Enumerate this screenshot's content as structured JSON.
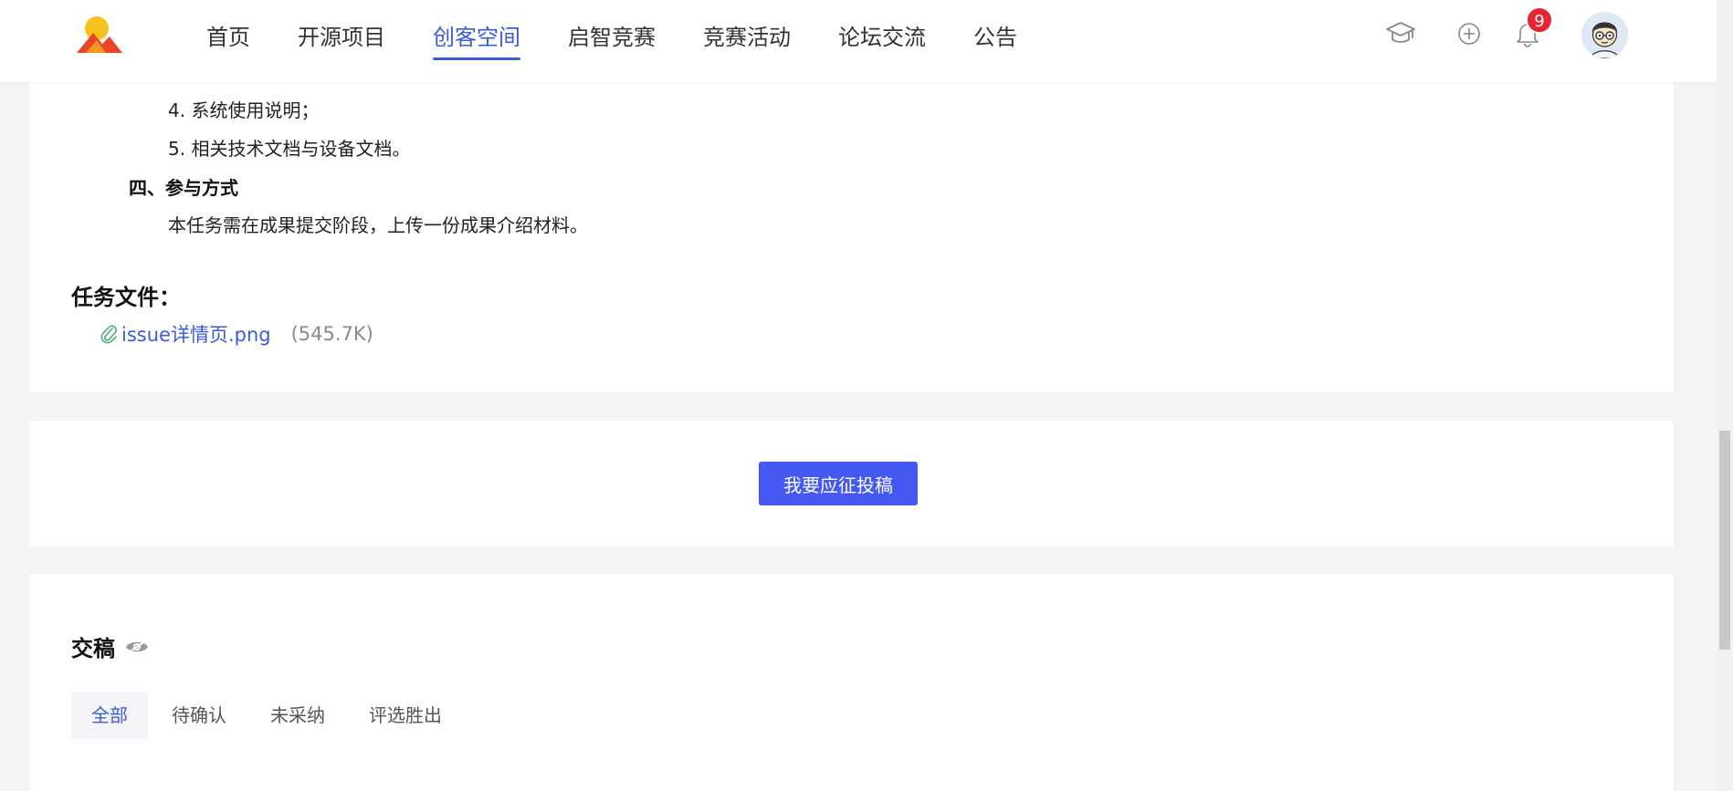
{
  "header": {
    "nav": [
      "首页",
      "开源项目",
      "创客空间",
      "启智竞赛",
      "竞赛活动",
      "论坛交流",
      "公告"
    ],
    "active_nav": "创客空间",
    "notification_count": "9",
    "icons": [
      "logo",
      "graduation-cap-icon",
      "plus-circle-icon",
      "bell-icon",
      "avatar"
    ]
  },
  "content": {
    "item_4": "4. 系统使用说明；",
    "item_5": "5. 相关技术文档与设备文档。",
    "section_heading": "四、参与方式",
    "section_body": "本任务需在成果提交阶段，上传一份成果介绍材料。",
    "files_heading": "任务文件：",
    "file_name": "issue详情页.png",
    "file_size": "(545.7K)"
  },
  "action": {
    "submit_label": "我要应征投稿"
  },
  "submissions": {
    "title": "交稿",
    "tabs": [
      "全部",
      "待确认",
      "未采纳",
      "评选胜出"
    ],
    "active_tab": "全部"
  },
  "colors": {
    "accent": "#3b5bdb",
    "button": "#4658f2",
    "badge": "#e5252f"
  }
}
